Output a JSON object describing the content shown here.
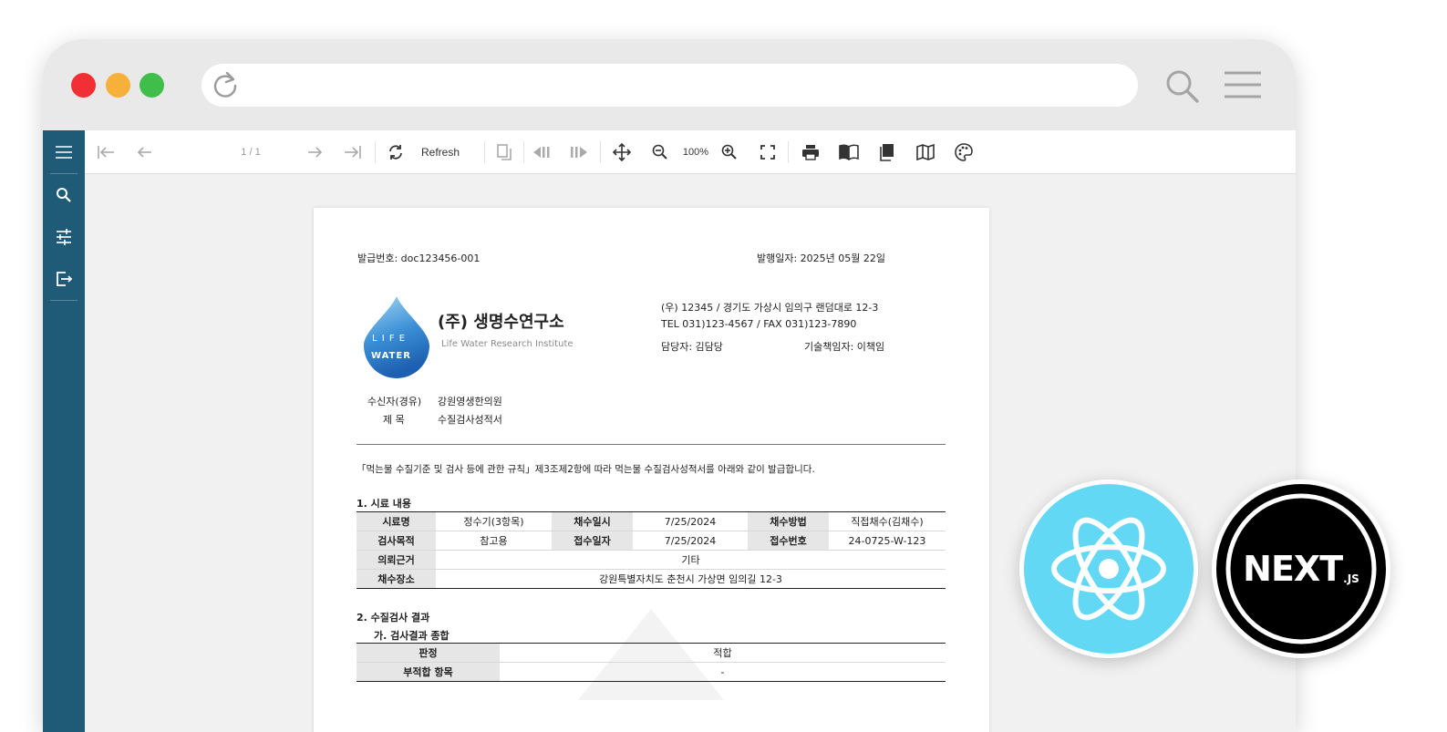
{
  "toolbar": {
    "page_indicator": "1 / 1",
    "refresh_label": "Refresh",
    "zoom_level": "100%"
  },
  "icons": {
    "sidebar": [
      "menu-icon",
      "search-icon",
      "sliders-icon",
      "export-icon"
    ],
    "toolbar": [
      "first-page-icon",
      "prev-page-icon",
      "next-page-icon",
      "last-page-icon",
      "refresh-icon",
      "copy-icon",
      "step-back-icon",
      "step-forward-icon",
      "move-icon",
      "zoom-out-icon",
      "zoom-in-icon",
      "fullscreen-icon",
      "print-icon",
      "book-icon",
      "document-icon",
      "map-icon",
      "palette-icon"
    ]
  },
  "document": {
    "issue_number": "발급번호: doc123456-001",
    "issue_date": "발행일자: 2025년 05월 22일",
    "logo_text": [
      "L I F E",
      "WATER"
    ],
    "company_name": "(주) 생명수연구소",
    "company_name_en": "Life Water Research Institute",
    "address": "(우) 12345 / 경기도 가상시 임의구 랜덤대로 12-3",
    "tel_fax": "TEL 031)123-4567 / FAX 031)123-7890",
    "manager": "담당자: 김담당",
    "tech_manager": "기술책임자: 이책임",
    "recipient_label": "수신자(경유)",
    "recipient_value": "강원영생한의원",
    "subject_label": "제 목",
    "subject_value": "수질검사성적서",
    "intro": "「먹는물 수질기준 및 검사 등에 관한 규칙」제3조제2항에 따라 먹는물 수질검사성적서를 아래와 같이 발급합니다.",
    "section1_title": "1. 시료 내용",
    "sample_table": {
      "sample_name_label": "시료명",
      "sample_name": "정수기(3항목)",
      "collect_date_label": "채수일시",
      "collect_date": "7/25/2024",
      "collect_method_label": "채수방법",
      "collect_method": "직접채수(김채수)",
      "purpose_label": "검사목적",
      "purpose": "참고용",
      "receipt_date_label": "접수일자",
      "receipt_date": "7/25/2024",
      "receipt_no_label": "접수번호",
      "receipt_no": "24-0725-W-123",
      "basis_label": "의뢰근거",
      "basis": "기타",
      "place_label": "채수장소",
      "place": "강원특별자치도 춘천시 가상면 임의길 12-3"
    },
    "section2_title": "2. 수질검사 결과",
    "section2_sub": "가. 검사결과 종합",
    "result_table": {
      "judgement_label": "판정",
      "judgement": "적합",
      "unfit_label": "부적합 항목",
      "unfit": "-"
    }
  },
  "badges": {
    "next_text": "NEXT",
    "next_suffix": ".JS"
  }
}
